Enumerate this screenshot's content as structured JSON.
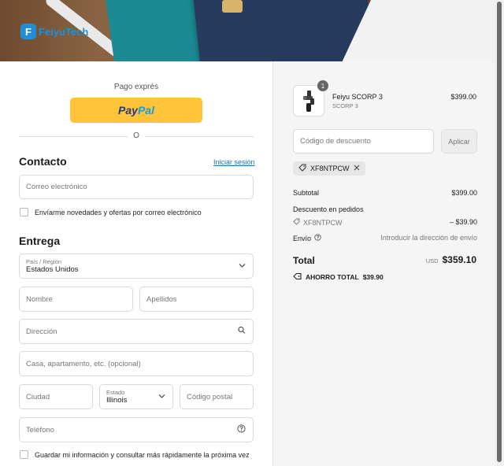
{
  "brand": {
    "logo_text": "FeiyuTech",
    "accent": "#1f8fd8"
  },
  "express": {
    "label": "Pago exprés",
    "paypal_part1": "Pay",
    "paypal_part2": "Pal",
    "divider_text": "O"
  },
  "contact": {
    "title": "Contacto",
    "login_link": "Iniciar sesión",
    "email_placeholder": "Correo electrónico",
    "newsletter_label": "Envíarme novedades y ofertas por correo electrónico"
  },
  "delivery": {
    "title": "Entrega",
    "country_label": "País / Región",
    "country_value": "Estados Unidos",
    "first_name": "Nombre",
    "last_name": "Apellidos",
    "address": "Dirección",
    "apartment": "Casa, apartamento, etc. (opcional)",
    "city": "Ciudad",
    "state_label": "Estado",
    "state_value": "Illinois",
    "postal": "Código postal",
    "phone": "Teléfono",
    "save_info_label": "Guardar mi información y consultar más rápidamente la próxima vez"
  },
  "order": {
    "item": {
      "quantity": "1",
      "name": "Feiyu SCORP 3",
      "variant": "SCORP 3",
      "price": "$399.00"
    },
    "discount_placeholder": "Código de descuento",
    "apply_label": "Aplicar",
    "applied_code": "XF8NTPCW",
    "subtotal_label": "Subtotal",
    "subtotal_value": "$399.00",
    "order_discount_label": "Descuento en pedidos",
    "discount_code": "XF8NTPCW",
    "discount_value": "– $39.90",
    "shipping_label": "Envío",
    "shipping_value": "Introducir la dirección de envío",
    "total_label": "Total",
    "currency": "USD",
    "total_value": "$359.10",
    "savings_label": "AHORRO TOTAL",
    "savings_value": "$39.90"
  }
}
